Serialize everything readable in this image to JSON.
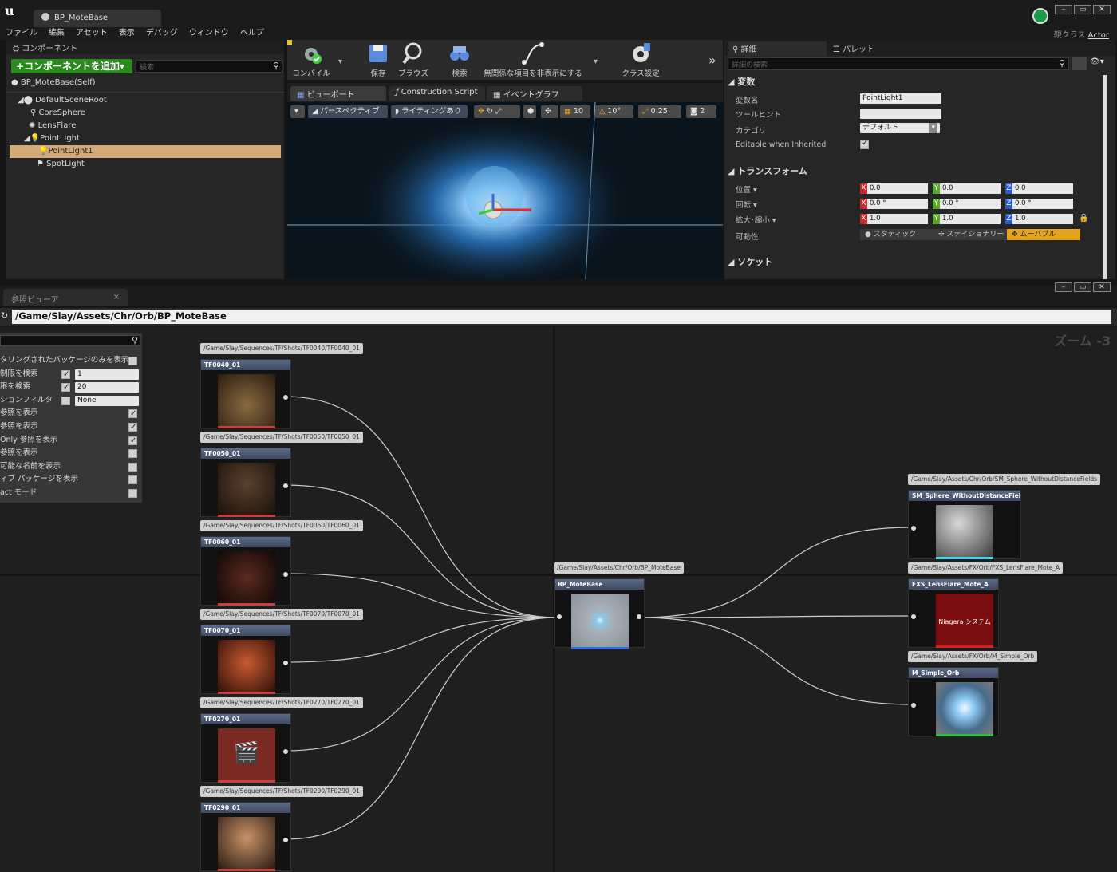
{
  "window": {
    "doc_tab": "BP_MoteBase",
    "menu": [
      "ファイル",
      "編集",
      "アセット",
      "表示",
      "デバッグ",
      "ウィンドウ",
      "ヘルプ"
    ],
    "parent_class_label": "親クラス",
    "parent_class_value": "Actor"
  },
  "components": {
    "tab": "コンポーネント",
    "add_button": "+コンポーネントを追加▾",
    "search_placeholder": "検索",
    "self": "BP_MoteBase(Self)",
    "tree": [
      "DefaultSceneRoot",
      "CoreSphere",
      "LensFlare",
      "PointLight",
      "PointLight1",
      "SpotLight"
    ]
  },
  "toolbar": {
    "compile": "コンパイル",
    "save": "保存",
    "browse": "ブラウズ",
    "find": "検索",
    "hide_unrelated": "無関係な項目を非表示にする",
    "class_settings": "クラス設定"
  },
  "viewport": {
    "tabs": [
      "ビューポート",
      "Construction Script",
      "イベントグラフ"
    ],
    "perspective": "パースペクティブ",
    "lighting": "ライティングあり",
    "grid": "10",
    "rot": "10°",
    "scale": "0.25",
    "cam": "2"
  },
  "details": {
    "tab_details": "詳細",
    "tab_palette": "パレット",
    "search_placeholder": "詳細の検索",
    "sections": [
      "変数",
      "トランスフォーム",
      "ソケット"
    ],
    "var_name_label": "変数名",
    "var_name": "PointLight1",
    "tooltip_label": "ツールヒント",
    "category_label": "カテゴリ",
    "category": "デフォルト",
    "editable_label": "Editable when Inherited",
    "pos_label": "位置 ▾",
    "rot_label": "回転 ▾",
    "scale_label": "拡大･縮小 ▾",
    "mobility_label": "可動性",
    "location": [
      "0.0",
      "0.0",
      "0.0"
    ],
    "rotation": [
      "0.0 °",
      "0.0 °",
      "0.0 °"
    ],
    "scale": [
      "1.0",
      "1.0",
      "1.0"
    ],
    "mobility": [
      "スタティック",
      "ステイショナリー",
      "ムーバブル"
    ],
    "axis": [
      "X",
      "Y",
      "Z"
    ]
  },
  "reference_viewer": {
    "tab": "参照ビューア",
    "path": "/Game/Slay/Assets/Chr/Orb/BP_MoteBase",
    "zoom": "ズーム -3",
    "filters": [
      {
        "label": "タリングされたパッケージのみを表示",
        "checked": false
      },
      {
        "label": "制限を検索",
        "checked": true,
        "value": "1"
      },
      {
        "label": "限を検索",
        "checked": true,
        "value": "20"
      },
      {
        "label": "ションフィルタ",
        "checked": false,
        "value": "None"
      },
      {
        "label": "参照を表示",
        "checked": true
      },
      {
        "label": "参照を表示",
        "checked": true
      },
      {
        "label": "Only 参照を表示",
        "checked": true
      },
      {
        "label": "参照を表示",
        "checked": false
      },
      {
        "label": "可能な名前を表示",
        "checked": false
      },
      {
        "label": "ィブ パッケージを表示",
        "checked": false
      },
      {
        "label": "act モード",
        "checked": false
      }
    ],
    "left_nodes": [
      {
        "path": "/Game/Slay/Sequences/TF/Shots/TF0040/TF0040_01",
        "name": "TF0040_01"
      },
      {
        "path": "/Game/Slay/Sequences/TF/Shots/TF0050/TF0050_01",
        "name": "TF0050_01"
      },
      {
        "path": "/Game/Slay/Sequences/TF/Shots/TF0060/TF0060_01",
        "name": "TF0060_01"
      },
      {
        "path": "/Game/Slay/Sequences/TF/Shots/TF0070/TF0070_01",
        "name": "TF0070_01"
      },
      {
        "path": "/Game/Slay/Sequences/TF/Shots/TF0270/TF0270_01",
        "name": "TF0270_01"
      },
      {
        "path": "/Game/Slay/Sequences/TF/Shots/TF0290/TF0290_01",
        "name": "TF0290_01"
      }
    ],
    "center_node": {
      "path": "/Game/Slay/Assets/Chr/Orb/BP_MoteBase",
      "name": "BP_MoteBase"
    },
    "right_nodes": [
      {
        "path": "/Game/Slay/Assets/Chr/Orb/SM_Sphere_WithoutDistanceFields",
        "name": "SM_Sphere_WithoutDistanceFields"
      },
      {
        "path": "/Game/Slay/Assets/FX/Orb/FXS_LensFlare_Mote_A",
        "name": "FXS_LensFlare_Mote_A",
        "thumb_text": "Niagara システム"
      },
      {
        "path": "/Game/Slay/Assets/FX/Orb/M_Simple_Orb",
        "name": "M_Simple_Orb"
      }
    ]
  }
}
